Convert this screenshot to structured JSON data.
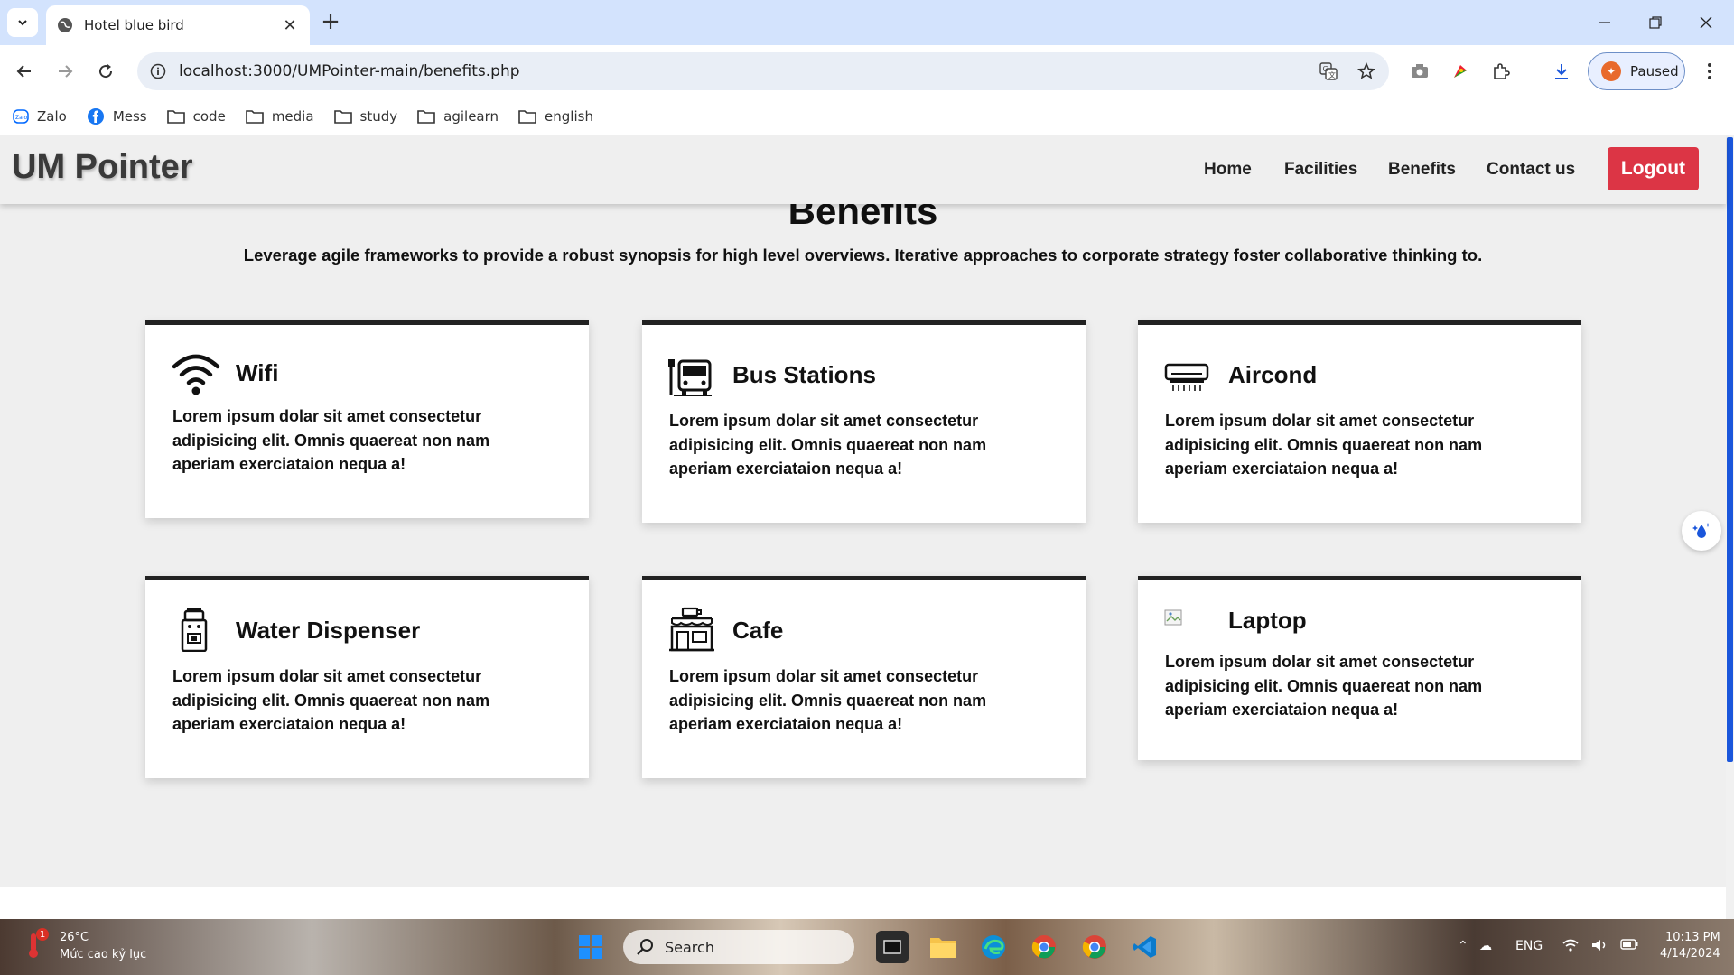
{
  "browser": {
    "tab_title": "Hotel blue bird",
    "url": "localhost:3000/UMPointer-main/benefits.php",
    "profile_label": "Paused",
    "bookmarks": [
      "Zalo",
      "Mess",
      "code",
      "media",
      "study",
      "agilearn",
      "english"
    ]
  },
  "site": {
    "brand": "UM Pointer",
    "nav": [
      "Home",
      "Facilities",
      "Benefits",
      "Contact us"
    ],
    "logout": "Logout"
  },
  "page": {
    "title": "Benefits",
    "subtitle": "Leverage agile frameworks to provide a robust synopsis for high level overviews. Iterative approaches to corporate strategy foster collaborative thinking to."
  },
  "cards": [
    {
      "title": "Wifi",
      "icon": "wifi-icon",
      "text": "Lorem ipsum dolar sit amet consectetur adipisicing elit. Omnis quaereat non nam aperiam exerciataion nequa a!"
    },
    {
      "title": "Bus Stations",
      "icon": "bus-station-icon",
      "text": "Lorem ipsum dolar sit amet consectetur adipisicing elit. Omnis quaereat non nam aperiam exerciataion nequa a!"
    },
    {
      "title": "Aircond",
      "icon": "air-conditioner-icon",
      "text": "Lorem ipsum dolar sit amet consectetur adipisicing elit. Omnis quaereat non nam aperiam exerciataion nequa a!"
    },
    {
      "title": "Water Dispenser",
      "icon": "water-dispenser-icon",
      "text": "Lorem ipsum dolar sit amet consectetur adipisicing elit. Omnis quaereat non nam aperiam exerciataion nequa a!"
    },
    {
      "title": "Cafe",
      "icon": "cafe-icon",
      "text": "Lorem ipsum dolar sit amet consectetur adipisicing elit. Omnis quaereat non nam aperiam exerciataion nequa a!"
    },
    {
      "title": "Laptop",
      "icon": "broken-image-icon",
      "text": "Lorem ipsum dolar sit amet consectetur adipisicing elit. Omnis quaereat non nam aperiam exerciataion nequa a!"
    }
  ],
  "taskbar": {
    "weather": "26°C",
    "weather_note": "Mức cao kỷ lục",
    "notification_count": "1",
    "search_placeholder": "Search",
    "language": "ENG",
    "time": "10:13 PM",
    "date": "4/14/2024"
  },
  "colors": {
    "logout_bg": "#dc3545",
    "tabstrip_bg": "#d3e3fd",
    "page_bg": "#efefef",
    "card_top_border": "#222222"
  }
}
